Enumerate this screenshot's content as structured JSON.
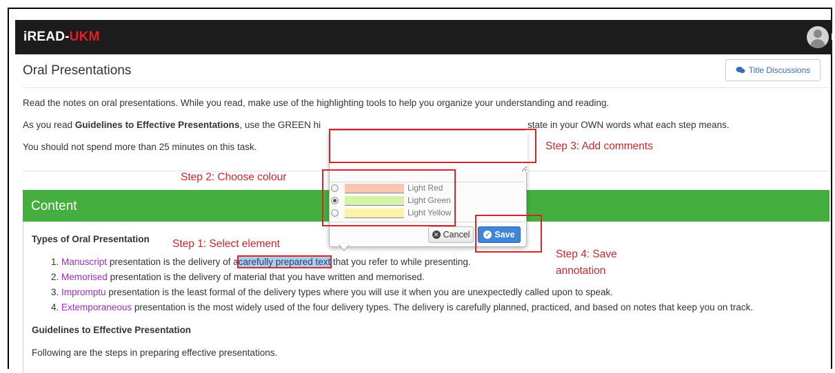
{
  "app": {
    "brand_main": "iREAD-",
    "brand_accent": "UKM",
    "user_initial": "M"
  },
  "page": {
    "title": "Oral Presentations",
    "title_discussions_label": "Title Discussions"
  },
  "instructions": {
    "line1": "Read the notes on oral presentations. While you read, make use of the highlighting tools to help you organize your understanding and reading.",
    "line2_prefix": "As you read ",
    "line2_bold": "Guidelines to Effective Presentations",
    "line2_mid": ", use the GREEN hi",
    "line2_suffix": "state in your OWN words what each step means.",
    "line3": "You should not spend more than 25 minutes on this task."
  },
  "content": {
    "header": "Content",
    "section1_heading": "Types of Oral Presentation",
    "items": [
      {
        "num": "1.",
        "term": "Manuscript",
        "text_before": " presentation is the delivery of a",
        "selected": "carefully prepared text",
        "text_after": " that you refer to while presenting."
      },
      {
        "num": "2.",
        "term": "Memorised",
        "text": " presentation is the delivery of material that you have written and memorised."
      },
      {
        "num": "3.",
        "term": "Impromptu",
        "text": " presentation is the least formal of the delivery types where you will use it when you are unexpectedly called upon to speak."
      },
      {
        "num": "4.",
        "term": "Extemporaneous",
        "text": " presentation is the most widely used of the four delivery types. The delivery is carefully planned, practiced, and based on notes that keep you on track."
      }
    ],
    "section2_heading": "Guidelines to Effective Presentation",
    "section2_text": "Following are the steps in preparing effective presentations."
  },
  "annotation_popup": {
    "comment_value": "",
    "colors": [
      {
        "label": "Light Red",
        "swatch": "#f9c6b4",
        "checked": false
      },
      {
        "label": "Light Green",
        "swatch": "#d6f2a6",
        "checked": true
      },
      {
        "label": "Light Yellow",
        "swatch": "#fbf3a8",
        "checked": false
      }
    ],
    "cancel_label": "Cancel",
    "save_label": "Save"
  },
  "steps": {
    "step1": "Step 1: Select element",
    "step2": "Step 2: Choose colour",
    "step3": "Step 3: Add comments",
    "step4_line1": "Step 4: Save",
    "step4_line2": "annotation"
  },
  "colors": {
    "navbar": "#1c1c1c",
    "brand_accent": "#e02020",
    "content_header": "#44ae3f",
    "term": "#9b2fbf",
    "step_annotation": "#c8272d",
    "save_button": "#3f86d6"
  }
}
